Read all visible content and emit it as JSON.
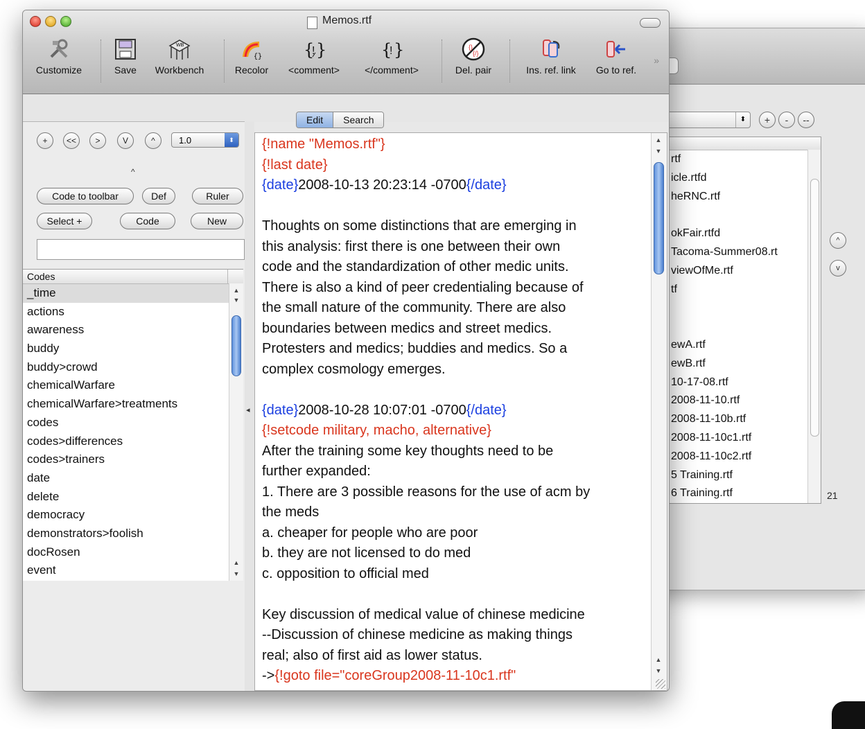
{
  "main_window": {
    "title": "Memos.rtf",
    "toolbar": [
      {
        "label": "Customize",
        "icon": "tools-icon"
      },
      {
        "label": "Save",
        "icon": "save-icon"
      },
      {
        "label": "Workbench",
        "icon": "workbench-icon"
      },
      {
        "label": "Recolor",
        "icon": "recolor-icon"
      },
      {
        "label": "<comment>",
        "icon": "comment-open-icon"
      },
      {
        "label": "</comment>",
        "icon": "comment-close-icon"
      },
      {
        "label": "Del. pair",
        "icon": "delete-pair-icon"
      },
      {
        "label": "Ins. ref. link",
        "icon": "insert-ref-link-icon"
      },
      {
        "label": "Go to ref.",
        "icon": "goto-ref-icon"
      }
    ],
    "tabs": [
      "Edit",
      "Search"
    ],
    "selected_tab": "Edit"
  },
  "left_pane": {
    "nav_buttons": [
      "+",
      "<<",
      ">",
      "V",
      "^"
    ],
    "zoom_value": "1.0",
    "buttons": {
      "code_to_toolbar": "Code to toolbar",
      "def": "Def",
      "ruler": "Ruler",
      "select_plus": "Select +",
      "code": "Code",
      "new": "New"
    },
    "codes_header": "Codes",
    "codes": [
      "_time",
      "actions",
      "awareness",
      "buddy",
      "buddy>crowd",
      "chemicalWarfare",
      "chemicalWarfare>treatments",
      "codes",
      "codes>differences",
      "codes>trainers",
      "date",
      "delete",
      "democracy",
      "demonstrators>foolish",
      "docRosen",
      "event"
    ]
  },
  "editor": {
    "lines": [
      [
        {
          "t": "{!name \"Memos.rtf\"}",
          "c": "red"
        }
      ],
      [
        {
          "t": "{!last date}",
          "c": "red"
        }
      ],
      [
        {
          "t": "{date}",
          "c": "blue"
        },
        {
          "t": "2008-10-13 20:23:14 -0700",
          "c": ""
        },
        {
          "t": "{/date}",
          "c": "blue"
        }
      ],
      [],
      [
        {
          "t": "Thoughts on some distinctions that are emerging in",
          "c": ""
        }
      ],
      [
        {
          "t": "this analysis: first there is one between their own",
          "c": ""
        }
      ],
      [
        {
          "t": "code and the standardization of other medic units.",
          "c": ""
        }
      ],
      [
        {
          "t": "There is also a kind of peer credentialing because of",
          "c": ""
        }
      ],
      [
        {
          "t": "the small nature of the community. There are also",
          "c": ""
        }
      ],
      [
        {
          "t": "boundaries between medics and street medics.",
          "c": ""
        }
      ],
      [
        {
          "t": "Protesters and medics; buddies and medics. So a",
          "c": ""
        }
      ],
      [
        {
          "t": "complex cosmology emerges.",
          "c": ""
        }
      ],
      [],
      [
        {
          "t": "{date}",
          "c": "blue"
        },
        {
          "t": "2008-10-28 10:07:01 -0700",
          "c": ""
        },
        {
          "t": "{/date}",
          "c": "blue"
        }
      ],
      [
        {
          "t": "{!setcode military, macho, alternative}",
          "c": "red"
        }
      ],
      [
        {
          "t": "After the training some key thoughts need to be",
          "c": ""
        }
      ],
      [
        {
          "t": "further expanded:",
          "c": ""
        }
      ],
      [
        {
          "t": "1. There are 3 possible reasons for the use of acm by",
          "c": ""
        }
      ],
      [
        {
          "t": "the meds",
          "c": ""
        }
      ],
      [
        {
          "t": "a. cheaper for people who are poor",
          "c": ""
        }
      ],
      [
        {
          "t": "b. they are not licensed to do med",
          "c": ""
        }
      ],
      [
        {
          "t": "c. opposition to official med",
          "c": ""
        }
      ],
      [],
      [
        {
          "t": "Key discussion of medical value of chinese medicine",
          "c": ""
        }
      ],
      [
        {
          "t": "--Discussion of chinese medicine as making things",
          "c": ""
        }
      ],
      [
        {
          "t": "real; also of first aid as lower status.",
          "c": ""
        }
      ],
      [
        {
          "t": "->",
          "c": ""
        },
        {
          "t": "{!goto file=\"coreGroup2008-11-10c1.rtf\"",
          "c": "red"
        }
      ]
    ]
  },
  "back_window": {
    "files": [
      "rtf",
      "icle.rtfd",
      "heRNC.rtf",
      "",
      "okFair.rtfd",
      "Tacoma-Summer08.rt",
      "viewOfMe.rtf",
      "tf",
      "",
      "",
      "ewA.rtf",
      "ewB.rtf",
      "10-17-08.rtf",
      "2008-11-10.rtf",
      "2008-11-10b.rtf",
      "2008-11-10c1.rtf",
      "2008-11-10c2.rtf",
      "5 Training.rtf",
      "6 Training.rtf"
    ],
    "count": "21",
    "buttons": [
      "+",
      "-",
      "--"
    ],
    "side_buttons": [
      "^",
      "v"
    ]
  }
}
